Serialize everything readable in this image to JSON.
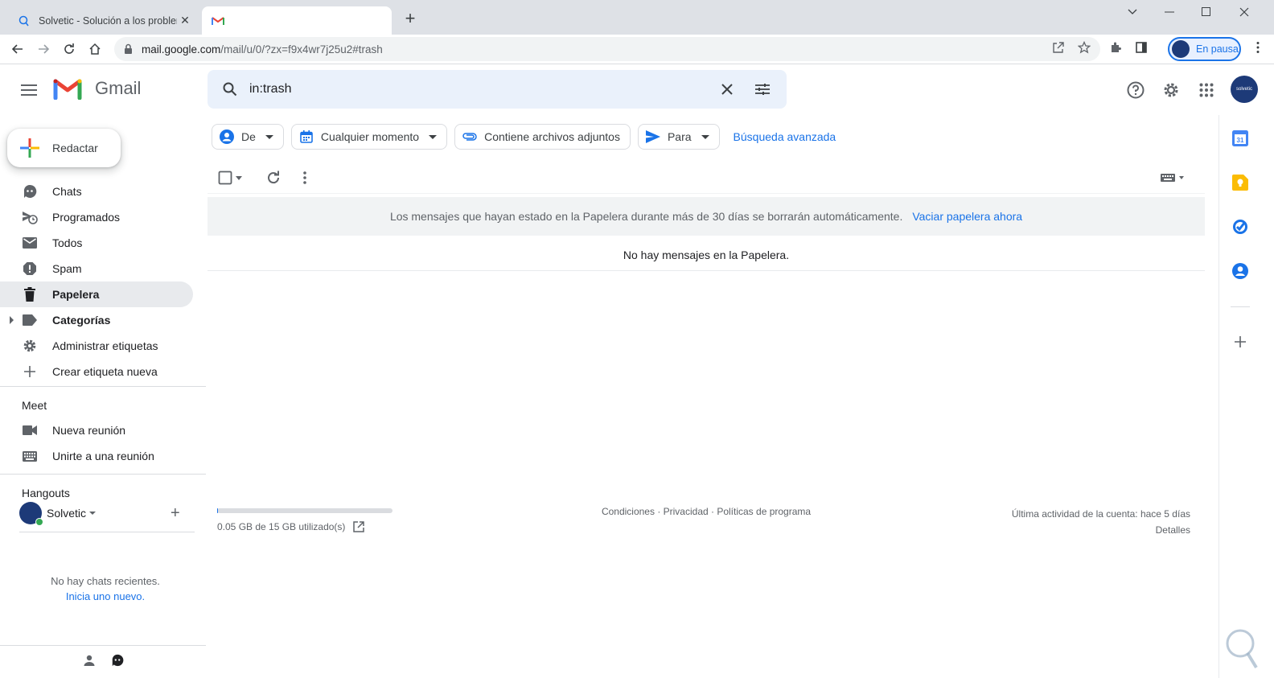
{
  "browser": {
    "tabs": [
      {
        "title": "Solvetic - Solución a los problemas"
      },
      {
        "title": ""
      }
    ],
    "url_host": "mail.google.com",
    "url_path": "/mail/u/0/?zx=f9x4wr7j25u2#trash",
    "profile_label": "En pausa"
  },
  "gmail": {
    "app_name": "Gmail",
    "search_value": "in:trash",
    "compose_label": "Redactar",
    "nav": [
      {
        "label": "Chats",
        "icon": "chat-icon"
      },
      {
        "label": "Programados",
        "icon": "scheduled-icon"
      },
      {
        "label": "Todos",
        "icon": "all-mail-icon"
      },
      {
        "label": "Spam",
        "icon": "spam-icon"
      },
      {
        "label": "Papelera",
        "icon": "trash-icon",
        "active": true
      },
      {
        "label": "Categorías",
        "icon": "label-icon"
      },
      {
        "label": "Administrar etiquetas",
        "icon": "gear-icon"
      },
      {
        "label": "Crear etiqueta nueva",
        "icon": "plus-icon"
      }
    ],
    "meet": {
      "title": "Meet",
      "items": [
        {
          "label": "Nueva reunión"
        },
        {
          "label": "Unirte a una reunión"
        }
      ]
    },
    "hangouts": {
      "title": "Hangouts",
      "user": "Solvetic",
      "no_chats": "No hay chats recientes.",
      "start_new": "Inicia uno nuevo."
    },
    "chips": [
      {
        "label": "De"
      },
      {
        "label": "Cualquier momento"
      },
      {
        "label": "Contiene archivos adjuntos"
      },
      {
        "label": "Para"
      }
    ],
    "advanced_search": "Búsqueda avanzada",
    "banner_text": "Los mensajes que hayan estado en la Papelera durante más de 30 días se borrarán automáticamente.",
    "banner_action": "Vaciar papelera ahora",
    "empty_text": "No hay mensajes en la Papelera.",
    "footer": {
      "storage": "0.05 GB de 15 GB utilizado(s)",
      "storage_fraction": 0.0033,
      "links": "Condiciones · Privacidad · Políticas de programa",
      "last_activity": "Última actividad de la cuenta: hace 5 días",
      "details": "Detalles"
    },
    "account_initials": "solvetic"
  },
  "colors": {
    "accent": "#1a73e8",
    "active_nav": "#e8eaed",
    "search_bg": "#eaf1fb"
  }
}
